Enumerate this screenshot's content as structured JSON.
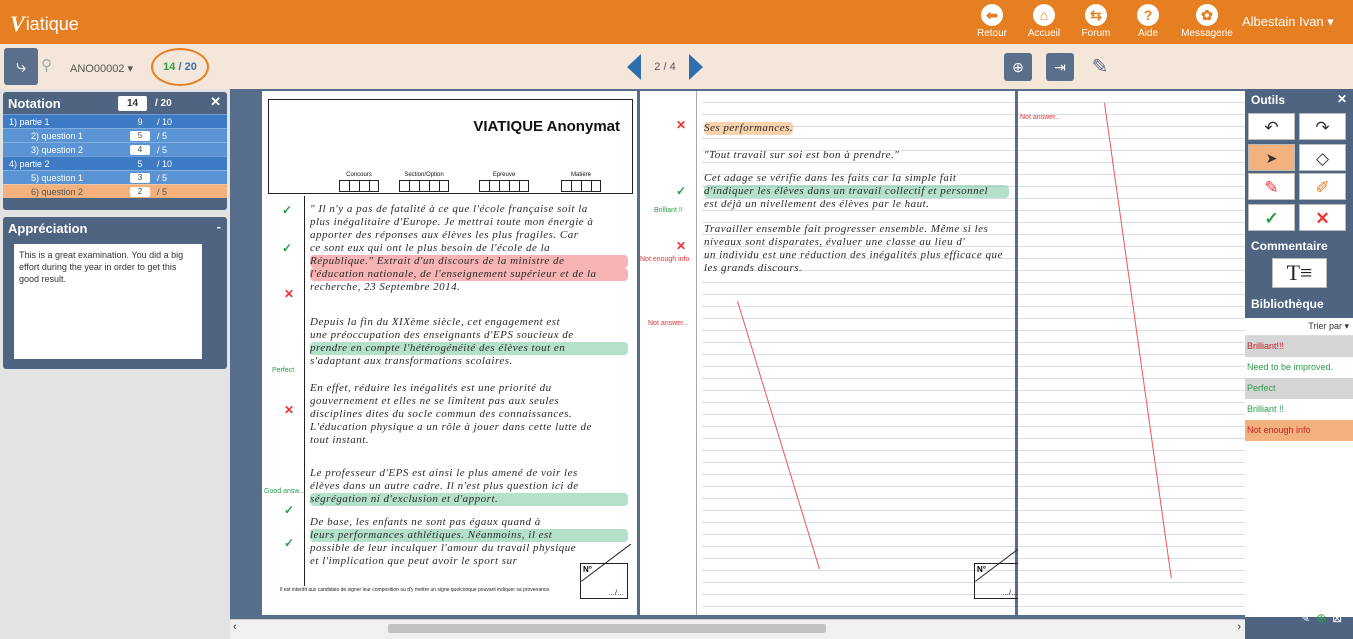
{
  "app": {
    "logo_v": "V",
    "logo_rest": "iatique",
    "user": "Albestain Ivan ▾"
  },
  "nav": [
    {
      "label": "Retour",
      "icon": "back-arrow-icon",
      "glyph": "⬅"
    },
    {
      "label": "Accueil",
      "icon": "home-icon",
      "glyph": "⌂"
    },
    {
      "label": "Forum",
      "icon": "forum-icon",
      "glyph": "⇆"
    },
    {
      "label": "Aide",
      "icon": "help-icon",
      "glyph": "?"
    },
    {
      "label": "Messagerie",
      "icon": "users-icon",
      "glyph": "✿"
    }
  ],
  "toolbar": {
    "anon": "ANO00002 ▾",
    "score_a": "14",
    "score_b": "/ 20",
    "pager": "2 / 4"
  },
  "notation": {
    "title": "Notation",
    "close": "✕",
    "total": "14",
    "max": "/ 20",
    "rows": [
      {
        "label": "1) partie 1",
        "score": "9",
        "max": "/ 10"
      },
      {
        "label": "2) question 1",
        "score": "5",
        "max": "/ 5"
      },
      {
        "label": "3) question 2",
        "score": "4",
        "max": "/ 5"
      },
      {
        "label": "4) partie 2",
        "score": "5",
        "max": "/ 10"
      },
      {
        "label": "5) question 1",
        "score": "3",
        "max": "/ 5"
      },
      {
        "label": "6) question 2",
        "score": "2",
        "max": "/ 5"
      }
    ]
  },
  "appreciation": {
    "title": "Appréciation",
    "collapse": "-",
    "text": "This is a great examination. You did a big effort during the year in order to get this good result."
  },
  "doc": {
    "title": "VIATIQUE Anonymat",
    "fields": [
      "Concours",
      "Section/Option",
      "Epreuve",
      "Matière"
    ],
    "nbox": "N°",
    "nbox_sub": "…/…",
    "footer": "Il est interdit aux candidats de signer leur composition ou d'y mettre un signe quelconque pouvant indiquer sa provenance.",
    "p1_lines": [
      "\" Il n'y a pas de fatalité à ce que l'école française soit la",
      "plus inégalitaire d'Europe. Je mettrai toute mon énergie à",
      "apporter des réponses aux élèves les plus fragiles. Car",
      "ce sont eux qui ont le plus besoin de l'école de la",
      "République.\"     Extrait d'un discours de la ministre de",
      "l'éducation nationale, de l'enseignement supérieur et de la",
      "recherche, 23 Septembre 2014.",
      "",
      "Depuis la fin du XIXème siècle, cet engagement est",
      "une préoccupation des enseignants d'EPS soucieux de",
      "prendre en compte l'hétérogénéité des élèves tout en",
      "s'adaptant aux transformations scolaires.",
      "",
      "En effet, réduire les inégalités est une priorité du",
      "gouvernement et elles ne se limitent pas aux seules",
      "disciplines dites du socle commun des connaissances.",
      "L'éducation physique a un rôle à jouer dans cette lutte de",
      "tout instant.",
      "",
      "Le professeur d'EPS est ainsi le plus amené de voir les",
      "élèves dans un autre cadre. Il n'est plus question ici de",
      "ségrégation ni d'exclusion et d'apport.",
      "",
      "De base, les enfants ne sont pas égaux quand à",
      "leurs performances athlétiques. Néanmoins, il est",
      "possible de leur inculquer l'amour du travail physique",
      "et l'implication que peut avoir le sport sur"
    ],
    "p2_lines": [
      "Ses performances.",
      "",
      "\"Tout travail sur soi est bon à prendre.\"",
      "",
      "Cet adage se vérifie dans les faits car la simple fait",
      "d'indiquer les élèves dans un travail collectif et personnel",
      "est déjà un nivellement des élèves par le haut.",
      "",
      "Travailler ensemble fait progresser ensemble. Même si les",
      "niveaux sont disparates, évaluer une classe au lieu d'",
      "un individu est une réduction des inégalités plus efficace que",
      "les grands discours."
    ],
    "p1_marks": [
      "✓",
      "✓",
      "✕",
      "Perfect",
      "✕",
      "Good answ...",
      "✓",
      "✓"
    ],
    "p2_marks": [
      "✕",
      "✓",
      "Brilliant !!",
      "✕",
      "Not enough info",
      "Not answer..."
    ],
    "p3_mark": "Not answer..."
  },
  "tools": {
    "title": "Outils",
    "close": "✕",
    "buttons": [
      {
        "name": "undo-icon",
        "glyph": "↶"
      },
      {
        "name": "redo-icon",
        "glyph": "↷"
      },
      {
        "name": "cursor-icon",
        "glyph": "➤"
      },
      {
        "name": "eraser-icon",
        "glyph": "◇"
      },
      {
        "name": "red-pencil-icon",
        "glyph": "✎"
      },
      {
        "name": "highlighter-icon",
        "glyph": "✐"
      },
      {
        "name": "check-icon",
        "glyph": "✓"
      },
      {
        "name": "cross-icon",
        "glyph": "✕"
      }
    ],
    "comment_title": "Commentaire",
    "comment_icon": "T≡",
    "biblio_title": "Bibliothèque",
    "sort": "Trier par ▾",
    "biblio": [
      {
        "label": "Brilliant!!!",
        "style": "gray red"
      },
      {
        "label": "Need to be improved.",
        "style": "white green"
      },
      {
        "label": "Perfect",
        "style": "gray green"
      },
      {
        "label": "Brilliant !!",
        "style": "white green"
      },
      {
        "label": "Not enough info",
        "style": "orange red"
      }
    ]
  },
  "colors": {
    "orange": "#e67e22",
    "panel": "#4e6481",
    "green": "#2a9d4a",
    "red": "#e33333"
  }
}
